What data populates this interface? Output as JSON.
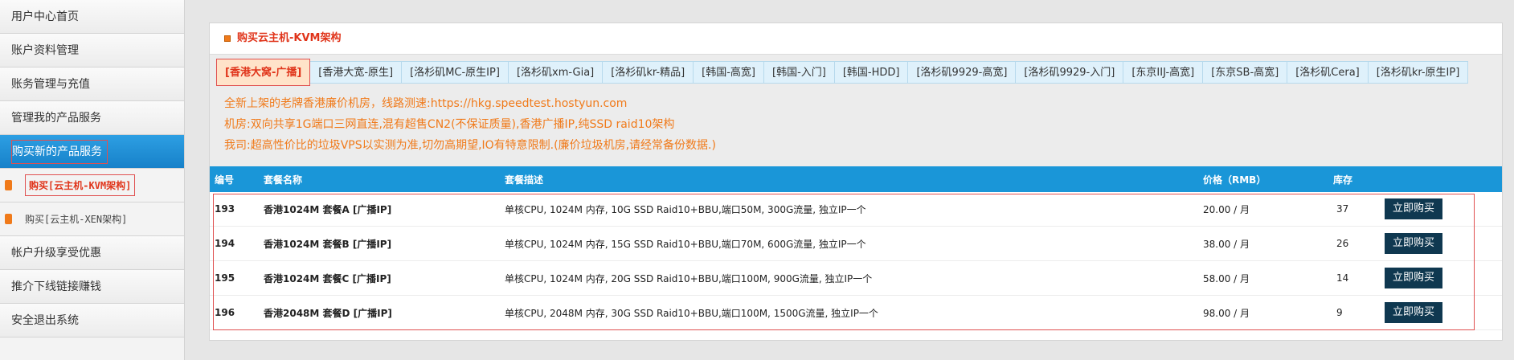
{
  "sidebar": {
    "items": [
      {
        "label": "用户中心首页"
      },
      {
        "label": "账户资料管理"
      },
      {
        "label": "账务管理与充值"
      },
      {
        "label": "管理我的产品服务"
      },
      {
        "label": "购买新的产品服务"
      }
    ],
    "sub_items": [
      {
        "label": "购买[云主机-KVM架构]"
      },
      {
        "label": "购买[云主机-XEN架构]"
      }
    ],
    "items_after": [
      {
        "label": "帐户升级享受优惠"
      },
      {
        "label": "推介下线链接赚钱"
      },
      {
        "label": "安全退出系统"
      }
    ]
  },
  "panel": {
    "title": "购买云主机-KVM架构"
  },
  "tabs": [
    "[香港大窝-广播]",
    "[香港大宽-原生]",
    "[洛杉矶MC-原生IP]",
    "[洛杉矶xm-Gia]",
    "[洛杉矶kr-精品]",
    "[韩国-高宽]",
    "[韩国-入门]",
    "[韩国-HDD]",
    "[洛杉矶9929-高宽]",
    "[洛杉矶9929-入门]",
    "[东京IIJ-高宽]",
    "[东京SB-高宽]",
    "[洛杉矶Cera]",
    "[洛杉矶kr-原生IP]"
  ],
  "notices": [
    "全新上架的老牌香港廉价机房，线路测速:https://hkg.speedtest.hostyun.com",
    "机房:双向共享1G端口三网直连,混有超售CN2(不保证质量),香港广播IP,纯SSD raid10架构",
    "我司:超高性价比的垃圾VPS以实测为准,切勿高期望,IO有特意限制.(廉价垃圾机房,请经常备份数据.)"
  ],
  "table": {
    "headers": {
      "id": "编号",
      "name": "套餐名称",
      "desc": "套餐描述",
      "price": "价格（RMB）",
      "stock": "库存"
    },
    "rows": [
      {
        "id": "193",
        "name": "香港1024M 套餐A [广播IP]",
        "desc": "单核CPU, 1024M 内存, 10G SSD Raid10+BBU,端口50M, 300G流量, 独立IP一个",
        "price": "20.00 / 月",
        "stock": "37",
        "button": "立即购买"
      },
      {
        "id": "194",
        "name": "香港1024M 套餐B [广播IP]",
        "desc": "单核CPU, 1024M 内存, 15G SSD Raid10+BBU,端口70M, 600G流量, 独立IP一个",
        "price": "38.00 / 月",
        "stock": "26",
        "button": "立即购买"
      },
      {
        "id": "195",
        "name": "香港1024M 套餐C [广播IP]",
        "desc": "单核CPU, 1024M 内存, 20G SSD Raid10+BBU,端口100M, 900G流量, 独立IP一个",
        "price": "58.00 / 月",
        "stock": "14",
        "button": "立即购买"
      },
      {
        "id": "196",
        "name": "香港2048M 套餐D [广播IP]",
        "desc": "单核CPU, 2048M 内存, 30G SSD Raid10+BBU,端口100M, 1500G流量, 独立IP一个",
        "price": "98.00 / 月",
        "stock": "9",
        "button": "立即购买"
      }
    ]
  },
  "colors": {
    "accent_orange": "#f07a1a",
    "accent_red": "#e0341a",
    "header_blue": "#1a96d8",
    "button_dark": "#0f3850"
  }
}
